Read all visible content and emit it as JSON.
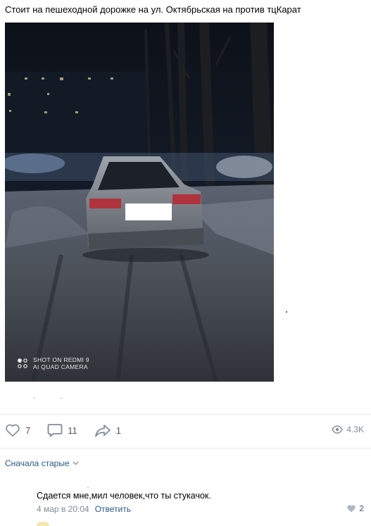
{
  "post": {
    "text": "Стоит на пешеходной дорожке на ул. Октябрьская на против тцКарат"
  },
  "photo": {
    "watermark_line1": "SHOT ON REDMI 9",
    "watermark_line2": "AI QUAD CAMERA",
    "icon": "camera-dots-icon"
  },
  "actions": {
    "likes": "7",
    "comments": "11",
    "shares": "1",
    "views": "4.3K",
    "icons": [
      "heart-icon",
      "comment-icon",
      "share-icon",
      "eye-icon"
    ]
  },
  "comments": {
    "sort_label": "Сначала старые",
    "items": [
      {
        "text": "Сдается мне,мил человек,что ты стукачок.",
        "date": "4 мар в 20:04",
        "reply_label": "Ответить",
        "likes": "2"
      }
    ]
  },
  "colors": {
    "link": "#2a5885",
    "muted": "#818c99",
    "divider": "#e7e8ec",
    "icon": "#818c99"
  }
}
